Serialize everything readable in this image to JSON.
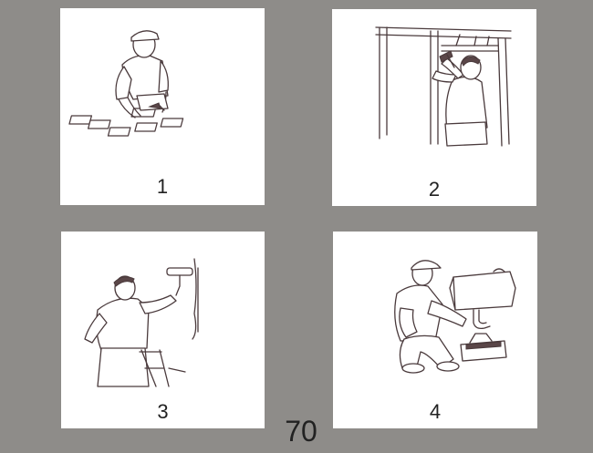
{
  "panels": [
    {
      "number": "1",
      "illustration": "bricklayer-illustration"
    },
    {
      "number": "2",
      "illustration": "carpenter-illustration"
    },
    {
      "number": "3",
      "illustration": "painter-illustration"
    },
    {
      "number": "4",
      "illustration": "plumber-illustration"
    }
  ],
  "page_number": "70",
  "colors": {
    "background": "#8e8c89",
    "card": "#ffffff",
    "ink": "#4a3a3c"
  }
}
